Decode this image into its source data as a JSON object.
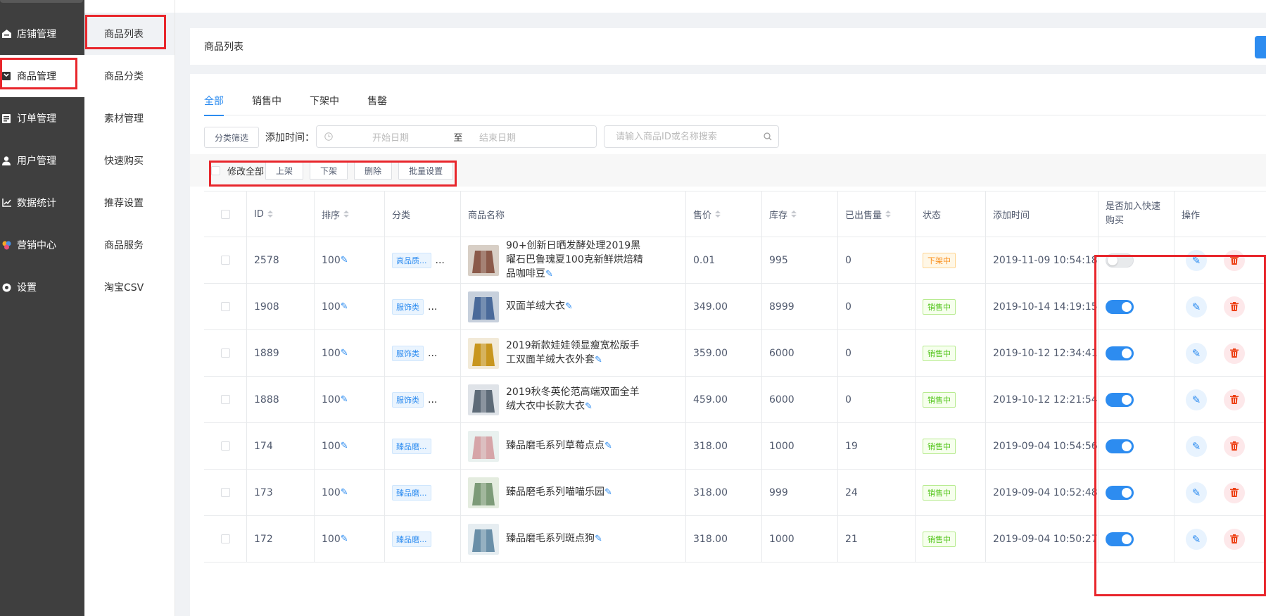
{
  "sidebar": {
    "items": [
      {
        "label": "店铺管理",
        "icon": "home-icon"
      },
      {
        "label": "商品管理",
        "icon": "goods-icon"
      },
      {
        "label": "订单管理",
        "icon": "order-icon"
      },
      {
        "label": "用户管理",
        "icon": "user-icon"
      },
      {
        "label": "数据统计",
        "icon": "chart-icon"
      },
      {
        "label": "营销中心",
        "icon": "marketing-icon"
      },
      {
        "label": "设置",
        "icon": "settings-icon"
      }
    ]
  },
  "submenu": {
    "items": [
      {
        "label": "商品列表"
      },
      {
        "label": "商品分类"
      },
      {
        "label": "素材管理"
      },
      {
        "label": "快速购买"
      },
      {
        "label": "推荐设置"
      },
      {
        "label": "商品服务"
      },
      {
        "label": "淘宝CSV"
      }
    ]
  },
  "page": {
    "title": "商品列表"
  },
  "tabs": [
    {
      "label": "全部"
    },
    {
      "label": "销售中"
    },
    {
      "label": "下架中"
    },
    {
      "label": "售罄"
    }
  ],
  "filters": {
    "category_button": "分类筛选",
    "date_label": "添加时间：",
    "start_placeholder": "开始日期",
    "range_sep": "至",
    "end_placeholder": "结束日期",
    "search_placeholder": "请输入商品ID或名称搜索"
  },
  "batch": {
    "select_all": "修改全部",
    "buttons": [
      "上架",
      "下架",
      "删除",
      "批量设置"
    ]
  },
  "table": {
    "headers": {
      "id": "ID",
      "sort": "排序",
      "category": "分类",
      "name": "商品名称",
      "price": "售价",
      "stock": "库存",
      "sold": "已出售量",
      "status": "状态",
      "time": "添加时间",
      "quick_buy_line1": "是否加入快速",
      "quick_buy_line2": "购买",
      "ops": "操作"
    },
    "rows": [
      {
        "id": "2578",
        "sort": "100",
        "category": "高品质...",
        "more": "...",
        "name": "90+创新日晒发酵处理2019黑曜石巴鲁瑰夏100克新鲜烘焙精品咖啡豆",
        "price": "0.01",
        "stock": "995",
        "sold": "0",
        "status": "下架中",
        "status_on": false,
        "time": "2019-11-09 10:54:18",
        "quick": false,
        "thumb": [
          "#8b5a4a",
          "#d8cfc6"
        ]
      },
      {
        "id": "1908",
        "sort": "100",
        "category": "服饰类",
        "more": "...",
        "name": "双面羊绒大衣",
        "price": "349.00",
        "stock": "8999",
        "sold": "0",
        "status": "销售中",
        "status_on": true,
        "time": "2019-10-14 14:19:15",
        "quick": true,
        "thumb": [
          "#4a6a9a",
          "#c7d0dc"
        ]
      },
      {
        "id": "1889",
        "sort": "100",
        "category": "服饰类",
        "more": "...",
        "name": "2019新款娃娃领显瘦宽松版手工双面羊绒大衣外套",
        "price": "359.00",
        "stock": "6000",
        "sold": "0",
        "status": "销售中",
        "status_on": true,
        "time": "2019-10-12 12:34:41",
        "quick": true,
        "thumb": [
          "#c8961e",
          "#f2ead8"
        ]
      },
      {
        "id": "1888",
        "sort": "100",
        "category": "服饰类",
        "more": "...",
        "name": "2019秋冬英伦范高端双面全羊绒大衣中长款大衣",
        "price": "459.00",
        "stock": "6000",
        "sold": "0",
        "status": "销售中",
        "status_on": true,
        "time": "2019-10-12 12:21:54",
        "quick": true,
        "thumb": [
          "#5e6b78",
          "#dfe3e8"
        ]
      },
      {
        "id": "174",
        "sort": "100",
        "category": "臻品磨...",
        "more": "",
        "name": "臻品磨毛系列草莓点点",
        "price": "318.00",
        "stock": "1000",
        "sold": "19",
        "status": "销售中",
        "status_on": true,
        "time": "2019-09-04 10:54:56",
        "quick": true,
        "thumb": [
          "#d6a5a8",
          "#e9f1ef"
        ]
      },
      {
        "id": "173",
        "sort": "100",
        "category": "臻品磨...",
        "more": "",
        "name": "臻品磨毛系列喵喵乐园",
        "price": "318.00",
        "stock": "999",
        "sold": "24",
        "status": "销售中",
        "status_on": true,
        "time": "2019-09-04 10:52:48",
        "quick": true,
        "thumb": [
          "#7d9b78",
          "#e4ecdf"
        ]
      },
      {
        "id": "172",
        "sort": "100",
        "category": "臻品磨...",
        "more": "",
        "name": "臻品磨毛系列斑点狗",
        "price": "318.00",
        "stock": "1000",
        "sold": "21",
        "status": "销售中",
        "status_on": true,
        "time": "2019-09-04 10:50:27",
        "quick": true,
        "thumb": [
          "#6a8fa8",
          "#e6edf1"
        ]
      }
    ]
  },
  "colors": {
    "primary": "#2d8cf0",
    "highlight": "#e8262c",
    "sidebar_bg": "#3f3f3f"
  }
}
